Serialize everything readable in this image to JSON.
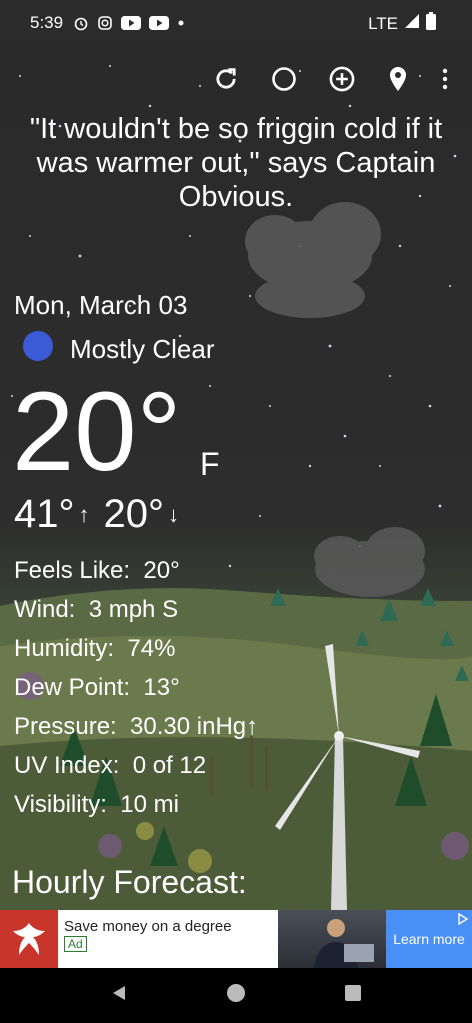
{
  "status_bar": {
    "time": "5:39",
    "network": "LTE"
  },
  "toolbar": {
    "icons": [
      "refresh-icon",
      "theme-icon",
      "add-location-icon",
      "location-pin-icon",
      "more-vert-icon"
    ]
  },
  "quote": "\"It wouldn't be so friggin cold if it was warmer out,\" says Captain Obvious.",
  "weather": {
    "date": "Mon, March 03",
    "condition": "Mostly Clear",
    "condition_icon": "moon-icon",
    "temperature": "20°",
    "unit": "F",
    "high": "41°",
    "low": "20°"
  },
  "details": [
    {
      "label": "Feels Like:",
      "value": "20°"
    },
    {
      "label": "Wind:",
      "value": "3 mph S"
    },
    {
      "label": "Humidity:",
      "value": "74%"
    },
    {
      "label": "Dew Point:",
      "value": "13°"
    },
    {
      "label": "Pressure:",
      "value": "30.30 inHg↑"
    },
    {
      "label": "UV Index:",
      "value": "0 of 12"
    },
    {
      "label": "Visibility:",
      "value": "10 mi"
    }
  ],
  "hourly_title": "Hourly Forecast:",
  "ad": {
    "headline": "Save money on a degree",
    "badge": "Ad",
    "cta": "Learn more"
  },
  "colors": {
    "sky": "#2a2a2a",
    "ground": "#4e5f43",
    "ad_cta": "#4a8ff5",
    "ad_logo": "#c8352a",
    "moon": "#3b5bd6"
  }
}
